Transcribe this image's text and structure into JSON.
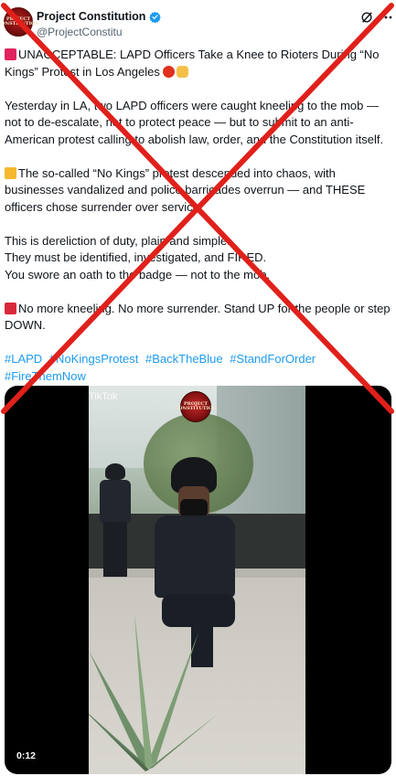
{
  "author": {
    "display_name": "Project Constitution",
    "handle": "@ProjectConstitu",
    "avatar_text": "PROJECT CONSTITUTION"
  },
  "post": {
    "headline": "UNACCEPTABLE: LAPD Officers Take a Knee to Rioters During “No Kings” Protest in Los Angeles",
    "paragraph_1": "Yesterday in LA, two LAPD officers were caught kneeling to the mob — not to de-escalate, not to protect peace — but to submit to an anti-American protest calling to abolish law, order, and the Constitution itself.",
    "paragraph_2": "The so-called “No Kings” protest descended into chaos, with businesses vandalized and police barricades overrun — and THESE officers chose surrender over service.",
    "paragraph_3_lines": [
      "This is dereliction of duty, plain and simple.",
      "They must be identified, investigated, and FIRED.",
      "You swore an oath to the badge — not to the mob."
    ],
    "paragraph_4": "No more kneeling. No more surrender. Stand UP for the people or step DOWN.",
    "hashtags": [
      "#LAPD",
      "#NoKingsProtest",
      "#BackTheBlue",
      "#StandForOrder",
      "#FireThemNow"
    ]
  },
  "media": {
    "duration": "0:12",
    "watermark_text": "PROJECT CONSTITUTION",
    "tiktok_label": "TikTok"
  },
  "colors": {
    "link": "#1d9bf0",
    "verified": "#1d9bf0",
    "cross": "#e0201b",
    "secondary_text": "#536471"
  },
  "icons": [
    "verified-badge-icon",
    "grok-icon",
    "more-icon",
    "alert-siren-icon",
    "angry-face-icon",
    "pointing-hand-icon",
    "crown-icon",
    "megaphone-icon",
    "tiktok-icon"
  ]
}
